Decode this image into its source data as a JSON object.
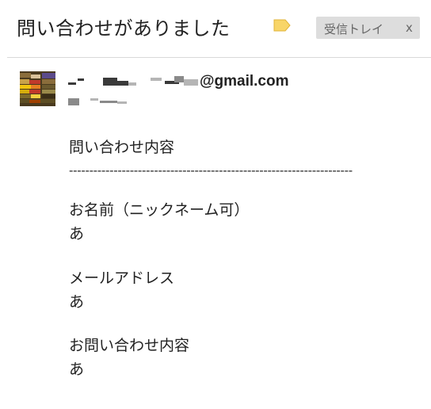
{
  "email": {
    "subject": "問い合わせがありました",
    "label_color": "#f8d568",
    "inbox_label": "受信トレイ",
    "inbox_close": "x",
    "sender_email_suffix": "@gmail.com"
  },
  "body": {
    "section_title": "問い合わせ内容",
    "separator": "----------------------------------------------------------------------",
    "fields": [
      {
        "label": "お名前（ニックネーム可）",
        "value": "あ"
      },
      {
        "label": "メールアドレス",
        "value": "あ"
      },
      {
        "label": "お問い合わせ内容",
        "value": "あ"
      }
    ]
  }
}
